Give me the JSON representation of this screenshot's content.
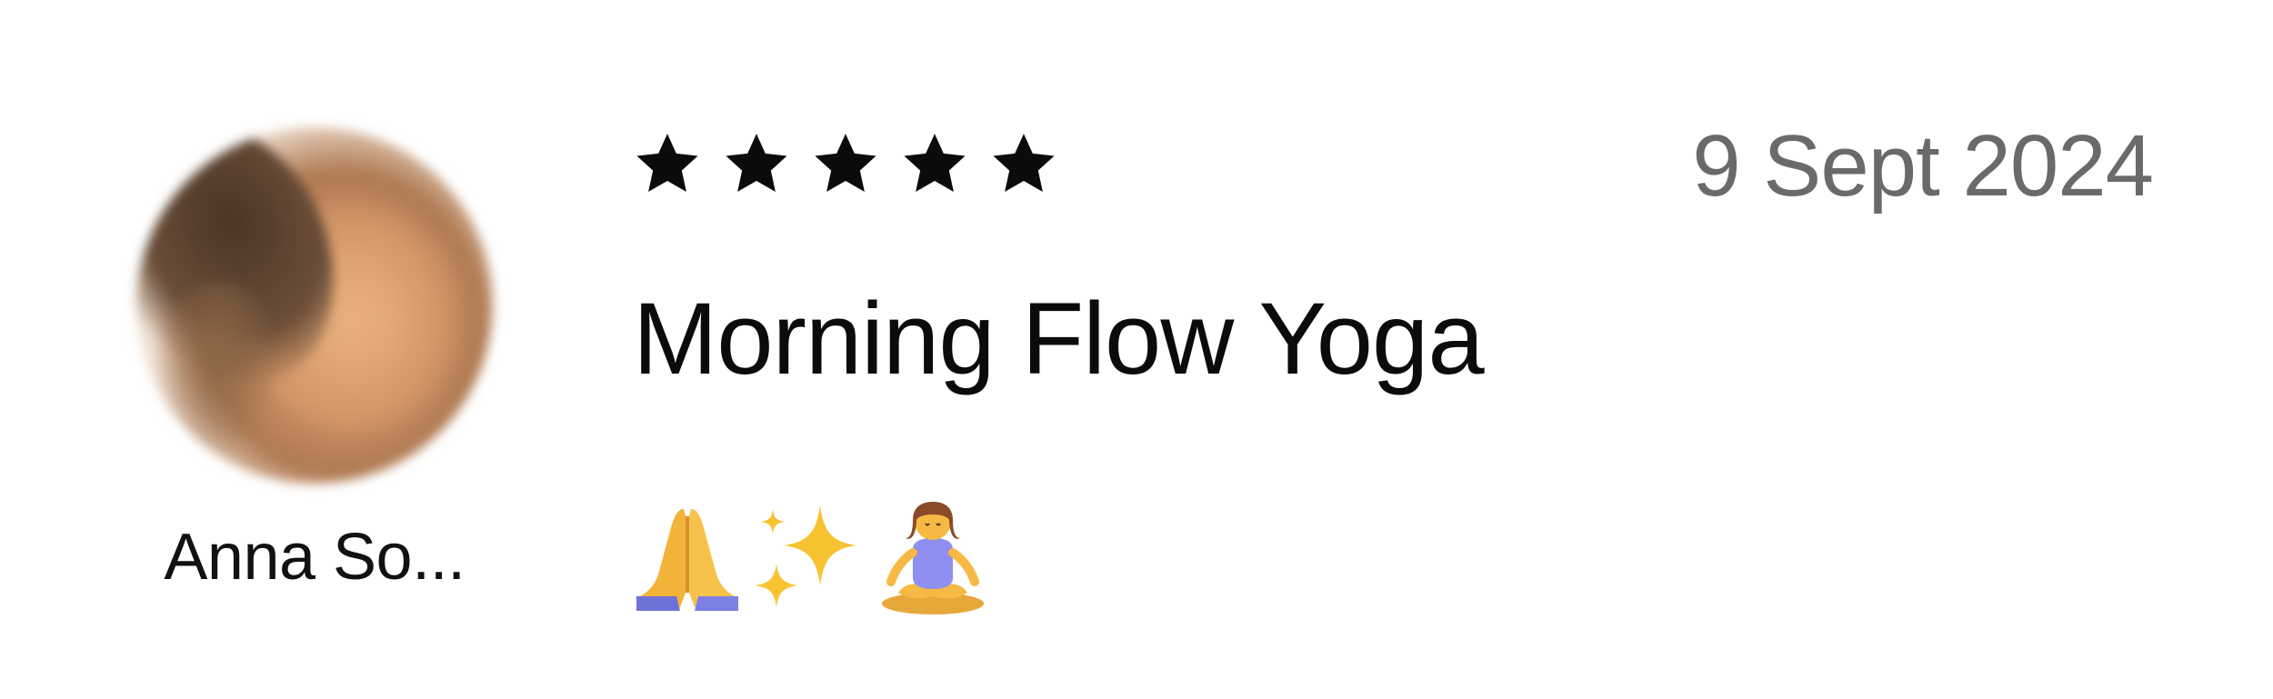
{
  "reviewer": {
    "name": "Anna So...",
    "avatar_icon": "blurred-profile-photo"
  },
  "rating": {
    "stars": 5,
    "max": 5,
    "icon": "star-icon",
    "color": "#0b0b0b"
  },
  "date": "9 Sept 2024",
  "title": "Morning Flow Yoga",
  "body": {
    "emoji": [
      "folded-hands-icon",
      "sparkles-icon",
      "person-in-lotus-position-icon"
    ]
  },
  "colors": {
    "text_primary": "#0b0b0b",
    "text_secondary": "#6a6a6a",
    "background": "#ffffff"
  }
}
